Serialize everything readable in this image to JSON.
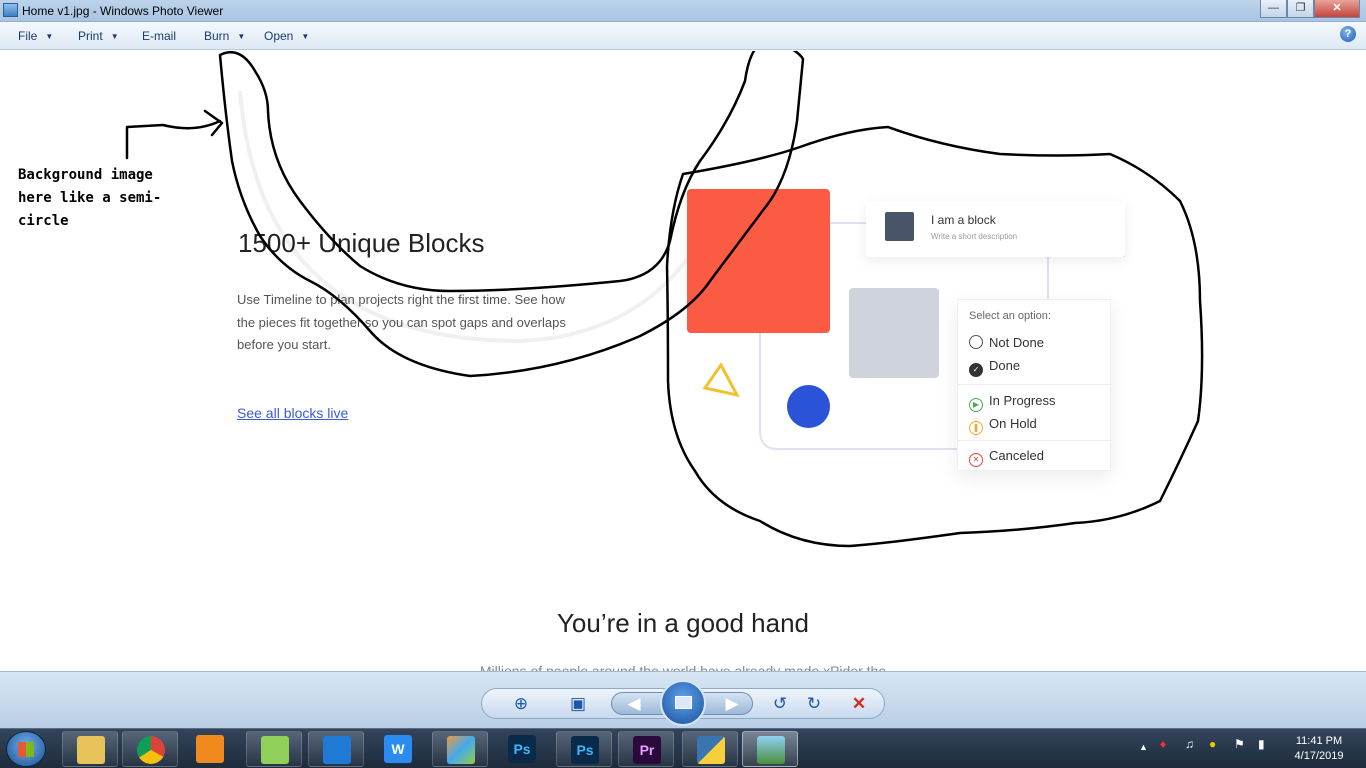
{
  "window": {
    "title": "Home v1.jpg - Windows Photo Viewer",
    "controls": [
      "minimize-icon",
      "maximize-icon",
      "close-icon"
    ]
  },
  "menu": {
    "items": [
      {
        "label": "File",
        "has_dropdown": true
      },
      {
        "label": "Print",
        "has_dropdown": true
      },
      {
        "label": "E-mail",
        "has_dropdown": false
      },
      {
        "label": "Burn",
        "has_dropdown": true
      },
      {
        "label": "Open",
        "has_dropdown": true
      }
    ],
    "help_icon": "help-icon",
    "help_label": "?"
  },
  "content": {
    "annotation": "Background image here like a semi-circle",
    "hero": {
      "title": "1500+ Unique Blocks",
      "description": "Use Timeline to plan projects right the first time. See how the pieces fit together so you can spot gaps and overlaps before you start.",
      "link": "See all blocks live"
    },
    "card": {
      "title": "I am a block",
      "subtitle": "Write a short description"
    },
    "options": {
      "heading": "Select an option:",
      "items": [
        {
          "label": "Not Done",
          "icon": "empty-circle-icon",
          "color": "#555555"
        },
        {
          "label": "Done",
          "icon": "check-circle-icon",
          "color": "#333333"
        },
        {
          "label": "In Progress",
          "icon": "play-circle-icon",
          "color": "#4caf50"
        },
        {
          "label": "On Hold",
          "icon": "pause-circle-icon",
          "color": "#f0a830"
        },
        {
          "label": "Canceled",
          "icon": "x-circle-icon",
          "color": "#e0483a"
        }
      ]
    },
    "section_title": "You’re in a good hand",
    "section_sub": "Millions of people around the world have already made xPider the"
  },
  "colors": {
    "red_block": "#fb5a43",
    "gray_block": "#cfd3db",
    "blue_dot": "#2a53d8",
    "link": "#3a5bd6"
  },
  "viewer_controls": [
    "zoom-icon",
    "fit-window-icon",
    "previous-icon",
    "slideshow-icon",
    "next-icon",
    "rotate-left-icon",
    "rotate-right-icon",
    "delete-icon"
  ],
  "taskbar": {
    "apps": [
      "Windows Explorer",
      "Google Chrome",
      "Media Player",
      "Notepad++",
      "Visual Studio Code",
      "WPS Writer",
      "Paint",
      "Photoshop",
      "Photoshop",
      "Premiere Pro",
      "Python",
      "Windows Photo Viewer"
    ],
    "app_glyphs": [
      "",
      "",
      "",
      "",
      "",
      "W",
      "",
      "Ps",
      "Ps",
      "Pr",
      "",
      ""
    ],
    "clock_time": "11:41 PM",
    "clock_date": "4/17/2019"
  }
}
